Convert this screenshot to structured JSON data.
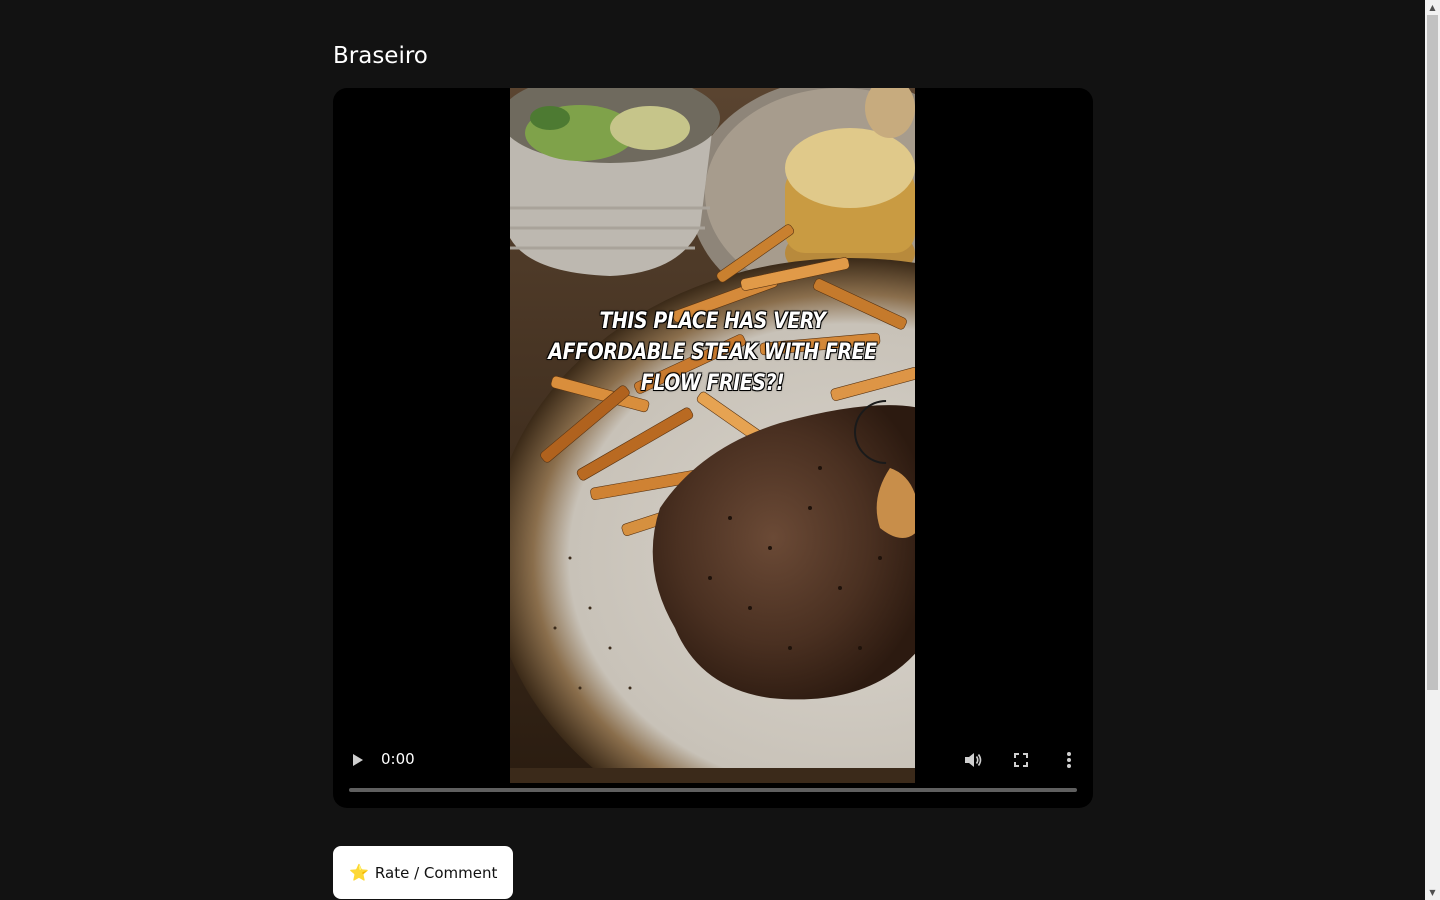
{
  "page": {
    "title": "Braseiro"
  },
  "video": {
    "overlay_caption": "This place has very affordable steak with free flow fries?!",
    "current_time": "0:00",
    "playback_progress": 0
  },
  "actions": {
    "rate_icon": "⭐",
    "rate_label": "Rate / Comment"
  },
  "icons": {
    "play": "play-icon",
    "volume": "volume-icon",
    "fullscreen": "fullscreen-icon",
    "more": "more-vertical-icon",
    "spinner": "loading-spinner-icon"
  }
}
